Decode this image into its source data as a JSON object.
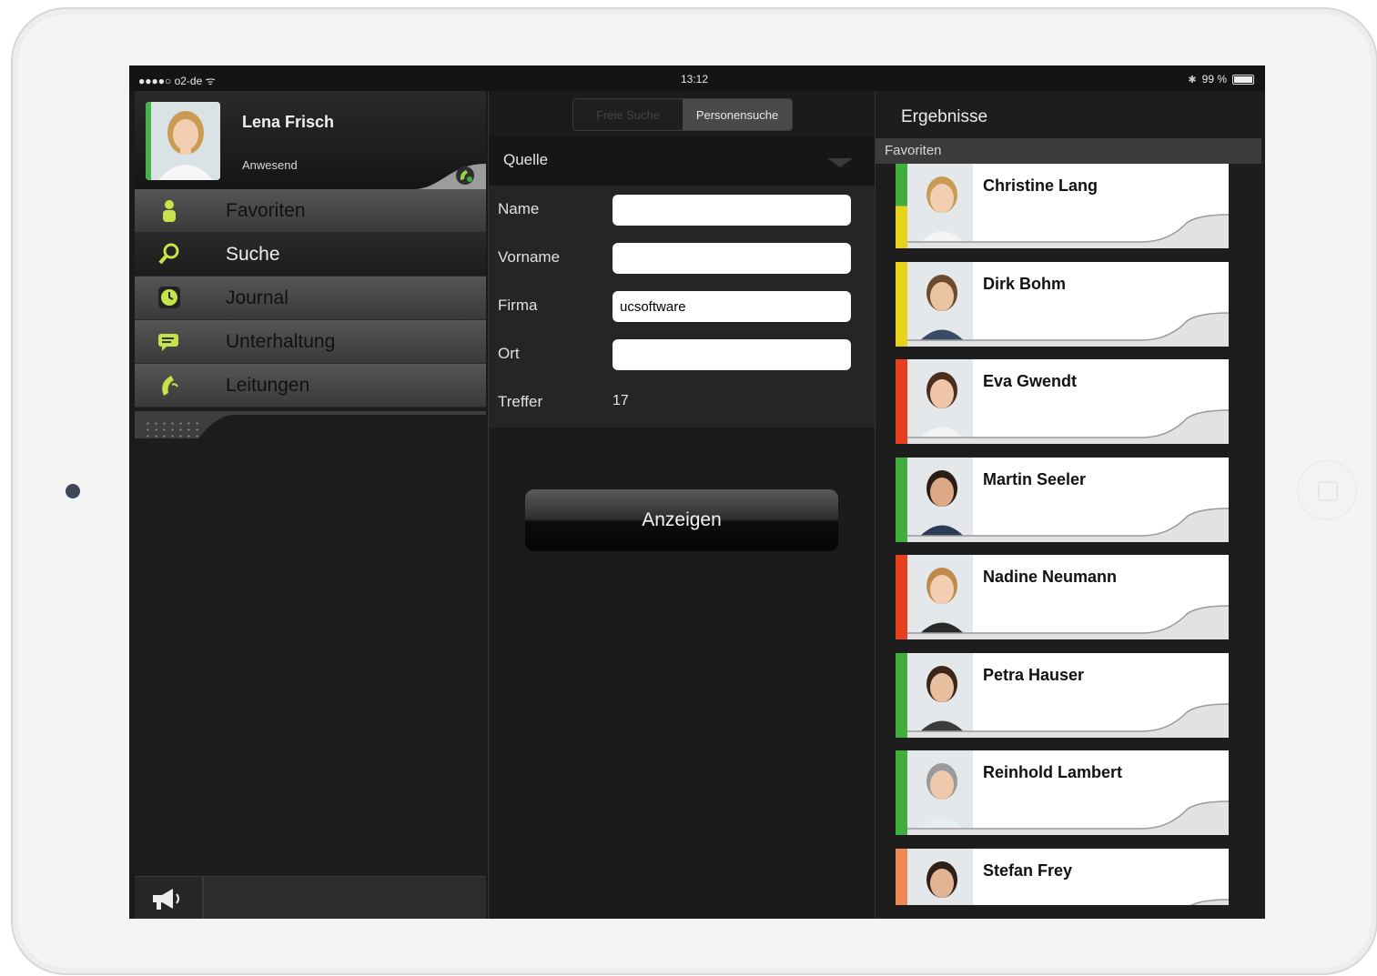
{
  "status_bar": {
    "carrier": "●●●●○ o2-de ᯤ",
    "time": "13:12",
    "battery": "99 %"
  },
  "profile": {
    "name": "Lena Frisch",
    "status": "Anwesend",
    "status_color": "#49b34a"
  },
  "menu": [
    {
      "label": "Favoriten",
      "icon": "person-icon",
      "active": false
    },
    {
      "label": "Suche",
      "icon": "search-icon",
      "active": true
    },
    {
      "label": "Journal",
      "icon": "clock-icon",
      "active": false
    },
    {
      "label": "Unterhaltung",
      "icon": "chat-icon",
      "active": false
    },
    {
      "label": "Leitungen",
      "icon": "phone-icon",
      "active": false
    }
  ],
  "search": {
    "tabs": [
      "Freie Suche",
      "Personensuche"
    ],
    "active_tab": "Personensuche",
    "source_label": "Quelle",
    "fields": [
      {
        "label": "Name",
        "value": ""
      },
      {
        "label": "Vorname",
        "value": ""
      },
      {
        "label": "Firma",
        "value": "ucsoftware"
      },
      {
        "label": "Ort",
        "value": ""
      }
    ],
    "hits_label": "Treffer",
    "hits_value": "17",
    "show_button": "Anzeigen"
  },
  "results": {
    "title": "Ergebnisse",
    "section": "Favoriten",
    "items": [
      {
        "name": "Christine Lang",
        "status": "yellow-green"
      },
      {
        "name": "Dirk Bohm",
        "status": "yellow"
      },
      {
        "name": "Eva Gwendt",
        "status": "red"
      },
      {
        "name": "Martin Seeler",
        "status": "green"
      },
      {
        "name": "Nadine Neumann",
        "status": "red"
      },
      {
        "name": "Petra Hauser",
        "status": "green"
      },
      {
        "name": "Reinhold Lambert",
        "status": "green"
      },
      {
        "name": "Stefan Frey",
        "status": "orange"
      }
    ]
  },
  "colors": {
    "accent_green": "#3fae3c",
    "accent_lime": "#c7e34a",
    "busy_red": "#e5411f"
  }
}
